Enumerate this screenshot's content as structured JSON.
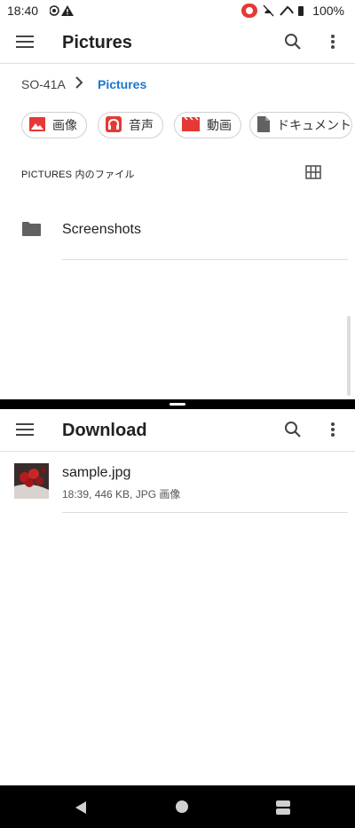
{
  "status_bar": {
    "time": "18:40",
    "battery": "100%"
  },
  "top_pane": {
    "title": "Pictures",
    "breadcrumb": {
      "root": "SO-41A",
      "current": "Pictures"
    },
    "chips": [
      {
        "label": "画像",
        "icon": "image-icon",
        "color": "#e53935"
      },
      {
        "label": "音声",
        "icon": "headphones-icon",
        "color": "#e53935"
      },
      {
        "label": "動画",
        "icon": "video-icon",
        "color": "#e53935"
      },
      {
        "label": "ドキュメント",
        "icon": "document-icon",
        "color": "#616161"
      }
    ],
    "section_label": "PICTURES 内のファイル",
    "items": [
      {
        "name": "Screenshots",
        "icon": "folder-icon"
      }
    ]
  },
  "bottom_pane": {
    "title": "Download",
    "items": [
      {
        "name": "sample.jpg",
        "meta": "18:39, 446 KB, JPG 画像",
        "icon": "image-thumbnail"
      }
    ]
  },
  "colors": {
    "accent": "#1976d2",
    "chip_icon_red": "#e53935"
  }
}
